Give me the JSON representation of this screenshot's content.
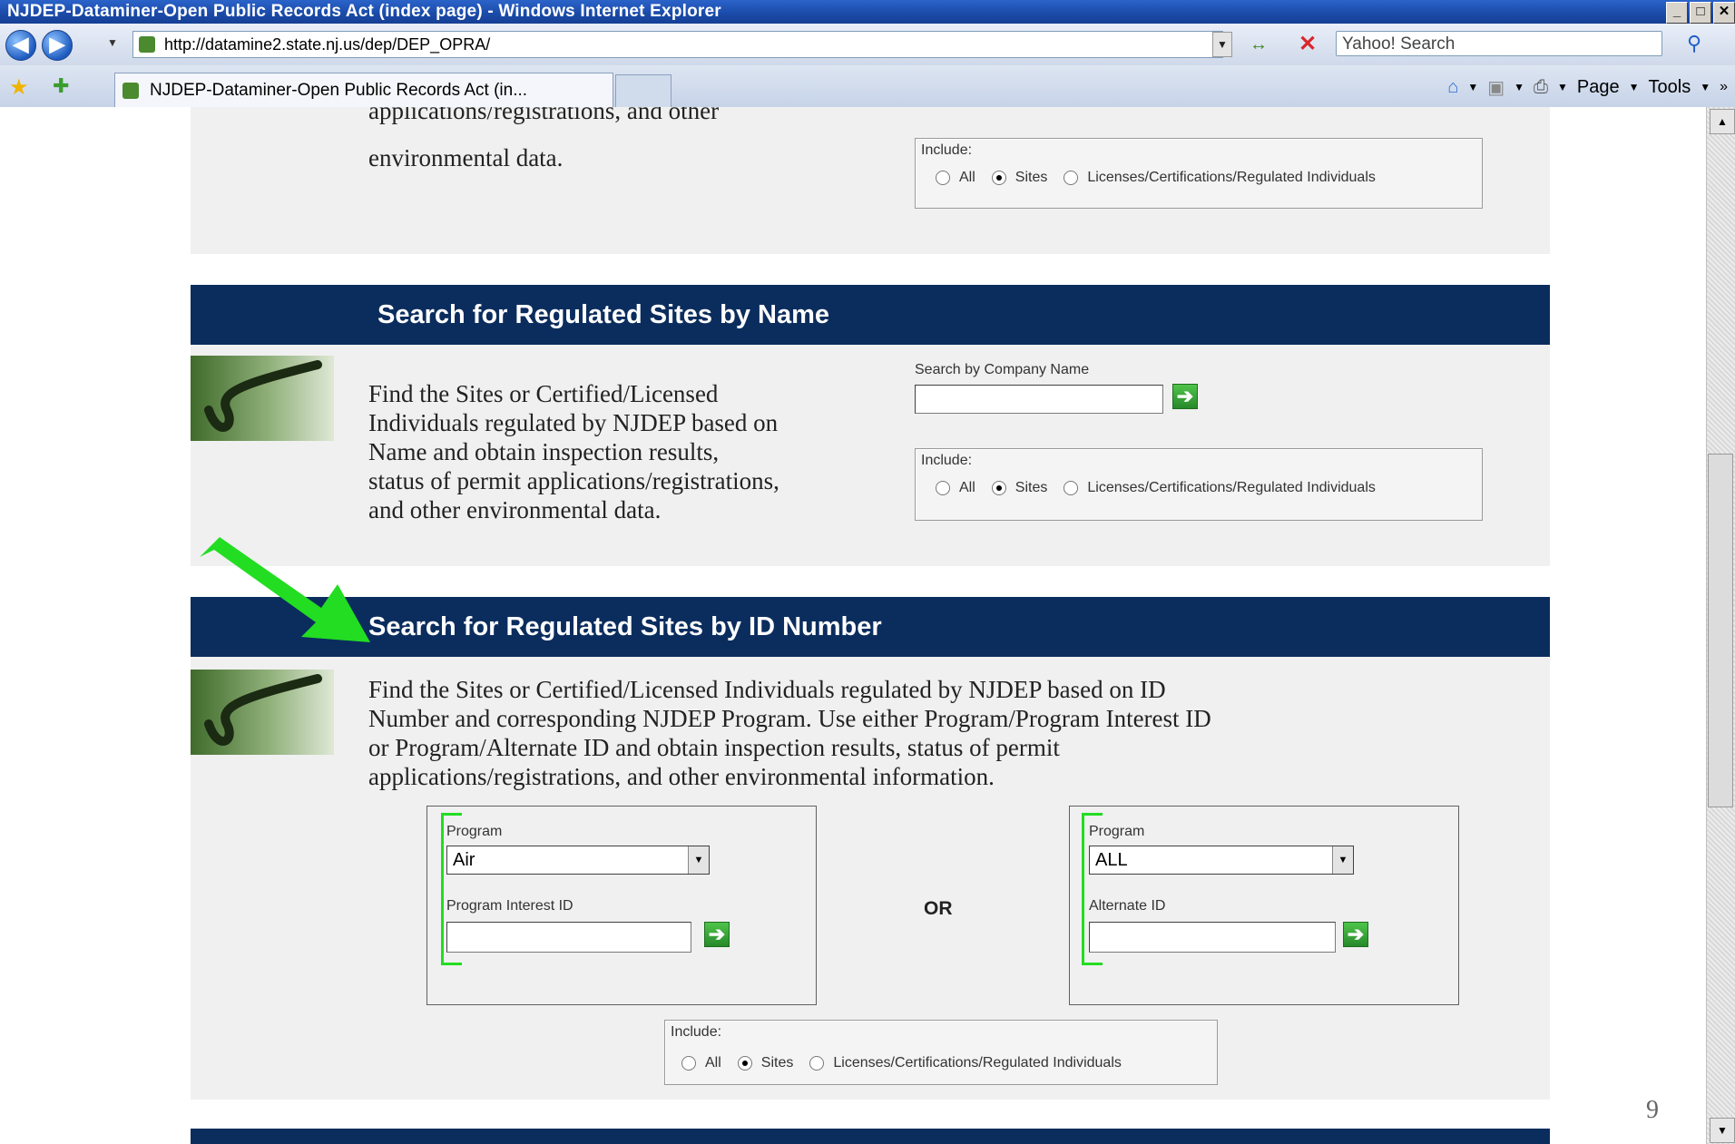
{
  "window": {
    "title": "NJDEP-Dataminer-Open Public Records Act (index page) - Windows Internet Explorer",
    "min_glyph": "_",
    "max_glyph": "□",
    "close_glyph": "✕"
  },
  "toolbar": {
    "url": "http://datamine2.state.nj.us/dep/DEP_OPRA/",
    "search_placeholder": "Yahoo! Search",
    "back_glyph": "◀",
    "forward_glyph": "▶",
    "dropdown_glyph": "▼",
    "refresh_glyph": "↔",
    "stop_glyph": "✕",
    "search_glyph": "⚲"
  },
  "tabs": {
    "active_label": "NJDEP-Dataminer-Open Public Records Act (in..."
  },
  "command_bar": {
    "page_label": "Page",
    "tools_label": "Tools",
    "home_glyph": "⌂",
    "feeds_glyph": "▣",
    "print_glyph": "⎙",
    "dropdown_glyph": "▼",
    "more_glyph": "»"
  },
  "section_top": {
    "text_line1": "applications/registrations, and other",
    "text_line2": "environmental data.",
    "include_label": "Include:",
    "options": [
      "All",
      "Sites",
      "Licenses/Certifications/Regulated Individuals"
    ],
    "selected": "Sites"
  },
  "section_name": {
    "header": "Search for Regulated Sites by Name",
    "description_lines": [
      "Find the Sites or Certified/Licensed",
      "Individuals regulated by NJDEP based on",
      "Name and obtain inspection results,",
      "status of permit applications/registrations,",
      "and other environmental data."
    ],
    "search_label": "Search by Company Name",
    "search_value": "",
    "include_label": "Include:",
    "options": [
      "All",
      "Sites",
      "Licenses/Certifications/Regulated Individuals"
    ],
    "selected": "Sites"
  },
  "section_id": {
    "header": "Search for Regulated Sites by ID Number",
    "description_lines": [
      "Find the Sites or Certified/Licensed Individuals regulated by NJDEP based on ID",
      "Number and corresponding NJDEP Program. Use either Program/Program Interest ID",
      "or Program/Alternate ID and obtain inspection results, status of permit",
      "applications/registrations, and other environmental information."
    ],
    "left": {
      "program_label": "Program",
      "program_value": "Air",
      "id_label": "Program Interest ID",
      "id_value": ""
    },
    "or_label": "OR",
    "right": {
      "program_label": "Program",
      "program_value": "ALL",
      "id_label": "Alternate ID",
      "id_value": ""
    },
    "include_label": "Include:",
    "options": [
      "All",
      "Sites",
      "Licenses/Certifications/Regulated Individuals"
    ],
    "selected": "Sites"
  },
  "annotation_colors": {
    "arrow": "#22dd22",
    "bracket": "#22dd22",
    "header_bg": "#0b2d5e"
  },
  "slide_number": "9"
}
